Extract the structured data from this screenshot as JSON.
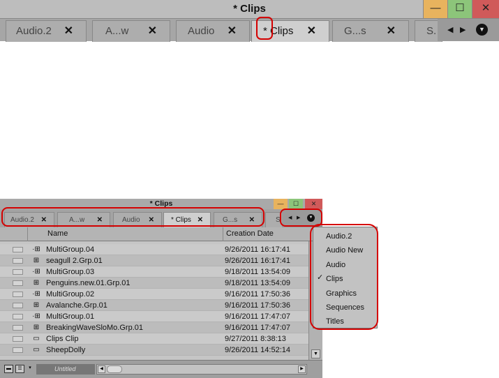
{
  "window": {
    "title": "* Clips",
    "minimize_glyph": "—",
    "maximize_glyph": "☐",
    "close_glyph": "✕"
  },
  "zoomed_tabs": [
    {
      "label": "Audio.2",
      "close": "✕"
    },
    {
      "label": "A...w",
      "close": "✕"
    },
    {
      "label": "Audio",
      "close": "✕"
    },
    {
      "label": "* Clips",
      "close": "✕"
    },
    {
      "label": "G...s",
      "close": "✕"
    },
    {
      "label": "S.",
      "close": ""
    }
  ],
  "tabs": [
    {
      "label": "Audio.2",
      "close": "✕"
    },
    {
      "label": "A...w",
      "close": "✕"
    },
    {
      "label": "Audio",
      "close": "✕"
    },
    {
      "label": "* Clips",
      "close": "✕"
    },
    {
      "label": "G...s",
      "close": "✕"
    },
    {
      "label": "S",
      "close": ""
    }
  ],
  "tab_nav": {
    "prev": "◀",
    "next": "▶",
    "menu": "▼"
  },
  "columns": {
    "name": "Name",
    "creation_date": "Creation Date"
  },
  "rows": [
    {
      "icon": "·⊞",
      "name": "MultiGroup.04",
      "date": "9/26/2011 16:17:41"
    },
    {
      "icon": "⊞",
      "name": "seagull 2.Grp.01",
      "date": "9/26/2011 16:17:41"
    },
    {
      "icon": "·⊞",
      "name": "MultiGroup.03",
      "date": "9/18/2011 13:54:09"
    },
    {
      "icon": "⊞",
      "name": "Penguins.new.01.Grp.01",
      "date": "9/18/2011 13:54:09"
    },
    {
      "icon": "·⊞",
      "name": "MultiGroup.02",
      "date": "9/16/2011 17:50:36"
    },
    {
      "icon": "⊞",
      "name": "Avalanche.Grp.01",
      "date": "9/16/2011 17:50:36"
    },
    {
      "icon": "·⊞",
      "name": "MultiGroup.01",
      "date": "9/16/2011 17:47:07"
    },
    {
      "icon": "⊞",
      "name": "BreakingWaveSloMo.Grp.01",
      "date": "9/16/2011 17:47:07"
    },
    {
      "icon": "▭",
      "name": "Clips Clip",
      "date": "9/27/2011 8:38:13"
    },
    {
      "icon": "▭",
      "name": "SheepDolly",
      "date": "9/26/2011 14:52:14"
    }
  ],
  "footer": {
    "bin_name": "Untitled"
  },
  "menu": {
    "items": [
      "Audio.2",
      "Audio New",
      "Audio",
      "Clips",
      "Graphics",
      "Sequences",
      "Titles"
    ],
    "checked_index": 3,
    "check_glyph": "✓"
  },
  "colors": {
    "minimize": "#e8b35e",
    "maximize": "#8cc57a",
    "close": "#d05a5a",
    "highlight": "#d40000"
  }
}
